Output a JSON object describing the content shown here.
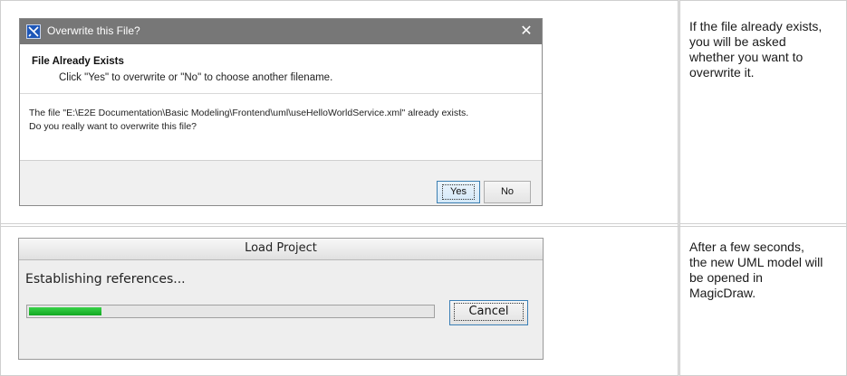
{
  "row1": {
    "description": "If the file already exists, you will be asked whether you want to overwrite it.",
    "dialog": {
      "title": "Overwrite this File?",
      "close_label": "✕",
      "header_title": "File Already Exists",
      "header_subtitle": "Click \"Yes\" to overwrite or \"No\" to choose another filename.",
      "message_line1": "The file \"E:\\E2E Documentation\\Basic Modeling\\Frontend\\uml\\useHelloWorldService.xml\" already exists.",
      "message_line2": "Do you really want to overwrite this file?",
      "yes_label": "Yes",
      "no_label": "No"
    }
  },
  "row2": {
    "description": "After a few seconds, the new UML model will be opened in MagicDraw.",
    "dialog": {
      "title": "Load Project",
      "status": "Establishing references...",
      "progress_fraction": 0.18,
      "cancel_label": "Cancel"
    }
  },
  "colors": {
    "progress_green": "#22c034",
    "titlebar_gray": "#777777"
  }
}
